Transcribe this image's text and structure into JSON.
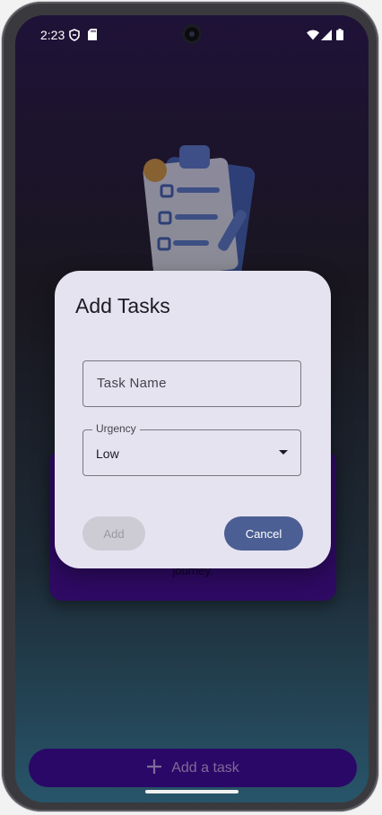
{
  "status_bar": {
    "time": "2:23",
    "left_icons": [
      "shield-icon",
      "sd-card-icon"
    ],
    "right_icons": [
      "wifi-icon",
      "signal-icon",
      "battery-icon"
    ]
  },
  "background_card": {
    "text": "journey."
  },
  "dialog": {
    "title": "Add Tasks",
    "task_name": {
      "placeholder": "Task Name",
      "value": ""
    },
    "urgency": {
      "label": "Urgency",
      "selected": "Low"
    },
    "add_label": "Add",
    "add_enabled": false,
    "cancel_label": "Cancel"
  },
  "fab": {
    "label": "Add a task",
    "icon": "plus-icon"
  },
  "colors": {
    "dialog_bg": "#e6e3f0",
    "cancel_button": "#4c5f94",
    "fab_bg": "#2a0868",
    "card_bg": "#2e0a63"
  }
}
